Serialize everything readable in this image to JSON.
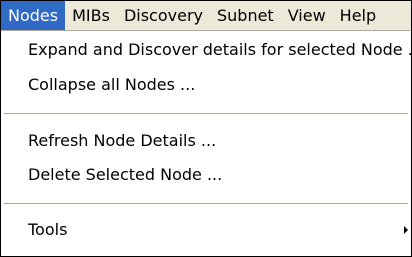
{
  "menubar": {
    "items": [
      {
        "label": "Nodes",
        "active": true
      },
      {
        "label": "MIBs"
      },
      {
        "label": "Discovery"
      },
      {
        "label": "Subnet"
      },
      {
        "label": "View"
      },
      {
        "label": "Help"
      }
    ]
  },
  "nodes_menu": {
    "items": [
      {
        "label": "Expand and Discover details for selected Node ..."
      },
      {
        "label": "Collapse all Nodes ..."
      },
      {
        "label": "Refresh Node Details ..."
      },
      {
        "label": "Delete Selected Node ..."
      },
      {
        "label": "Tools",
        "submenu_icon": "chevron-right-icon"
      }
    ]
  },
  "colors": {
    "menubar_bg": "#ece9d8",
    "highlight": "#316ac5",
    "separator": "#aca899"
  }
}
